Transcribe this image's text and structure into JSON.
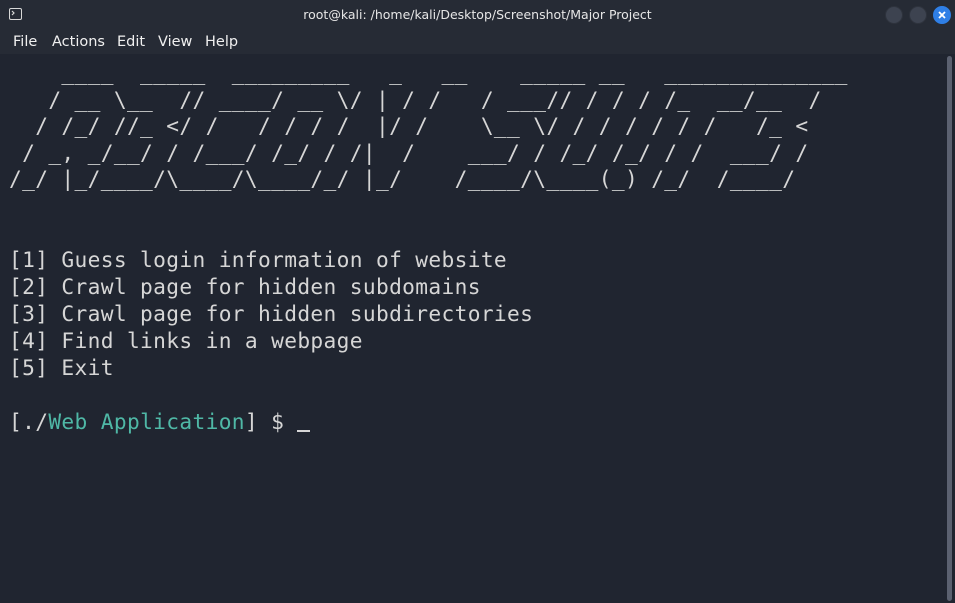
{
  "window": {
    "title": "root@kali: /home/kali/Desktop/Screenshot/Major Project",
    "close_color": "#2f7fe6"
  },
  "menu": {
    "items": [
      "File",
      "Actions",
      "Edit",
      "View",
      "Help"
    ]
  },
  "terminal": {
    "banner_lines": [
      "    ____  _____  _________   _   __    _____ __   ______________",
      "   / __ \\__  // ____/ __ \\/ | / /   / ___// / / / /_  __/__  /",
      "  / /_/ //_ </ /   / / / /  |/ /    \\__ \\/ / / / / / /   /_ <",
      " / _, _/__/ / /___/ /_/ / /|  /    ___/ / /_/ /_/ / /  ___/ /",
      "/_/ |_/____/\\____/\\____/_/ |_/    /____/\\____(_) /_/  /____/"
    ],
    "menu_options": [
      "[1] Guess login information of website",
      "[2] Crawl page for hidden subdomains",
      "[3] Crawl page for hidden subdirectories",
      "[4] Find links in a webpage",
      "[5] Exit"
    ],
    "prompt": {
      "prefix": "[./",
      "app": "Web Application",
      "suffix": "] $ ",
      "app_color": "#4fb8a6"
    }
  }
}
